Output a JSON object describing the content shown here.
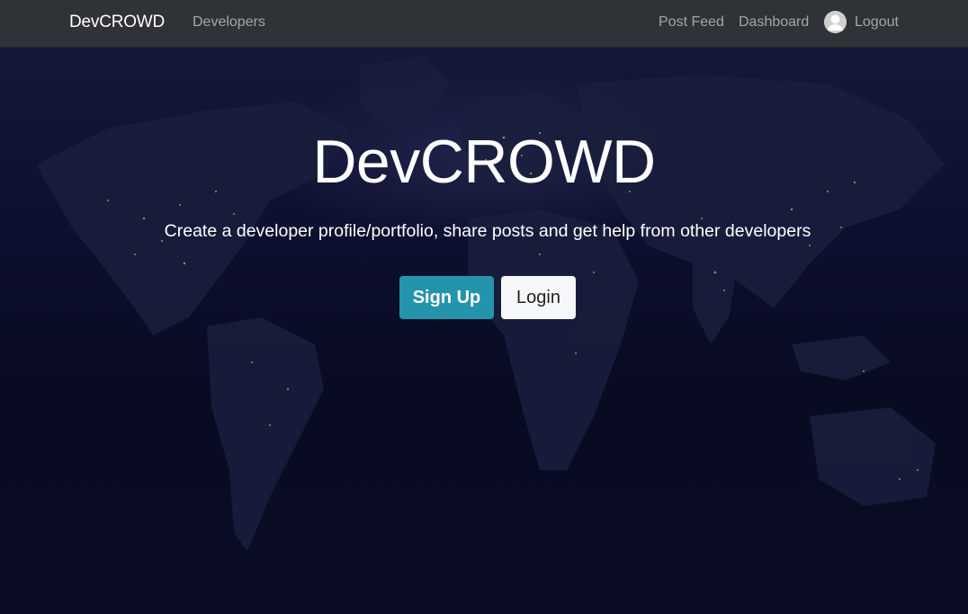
{
  "navbar": {
    "brand": "DevCROWD",
    "left_links": [
      "Developers"
    ],
    "right_links": {
      "post_feed": "Post Feed",
      "dashboard": "Dashboard",
      "logout": "Logout"
    },
    "avatar_icon": "user-avatar-icon"
  },
  "hero": {
    "title": "DevCROWD",
    "lead": "Create a developer profile/portfolio, share posts and get help from other developers",
    "background": "world-map-at-night",
    "buttons": {
      "signup": "Sign Up",
      "login": "Login"
    }
  },
  "colors": {
    "navbar_bg": "#2f3236",
    "signup_bg": "#2493ac",
    "login_bg": "#f6f7f9",
    "hero_bg": "#0b0d20"
  }
}
